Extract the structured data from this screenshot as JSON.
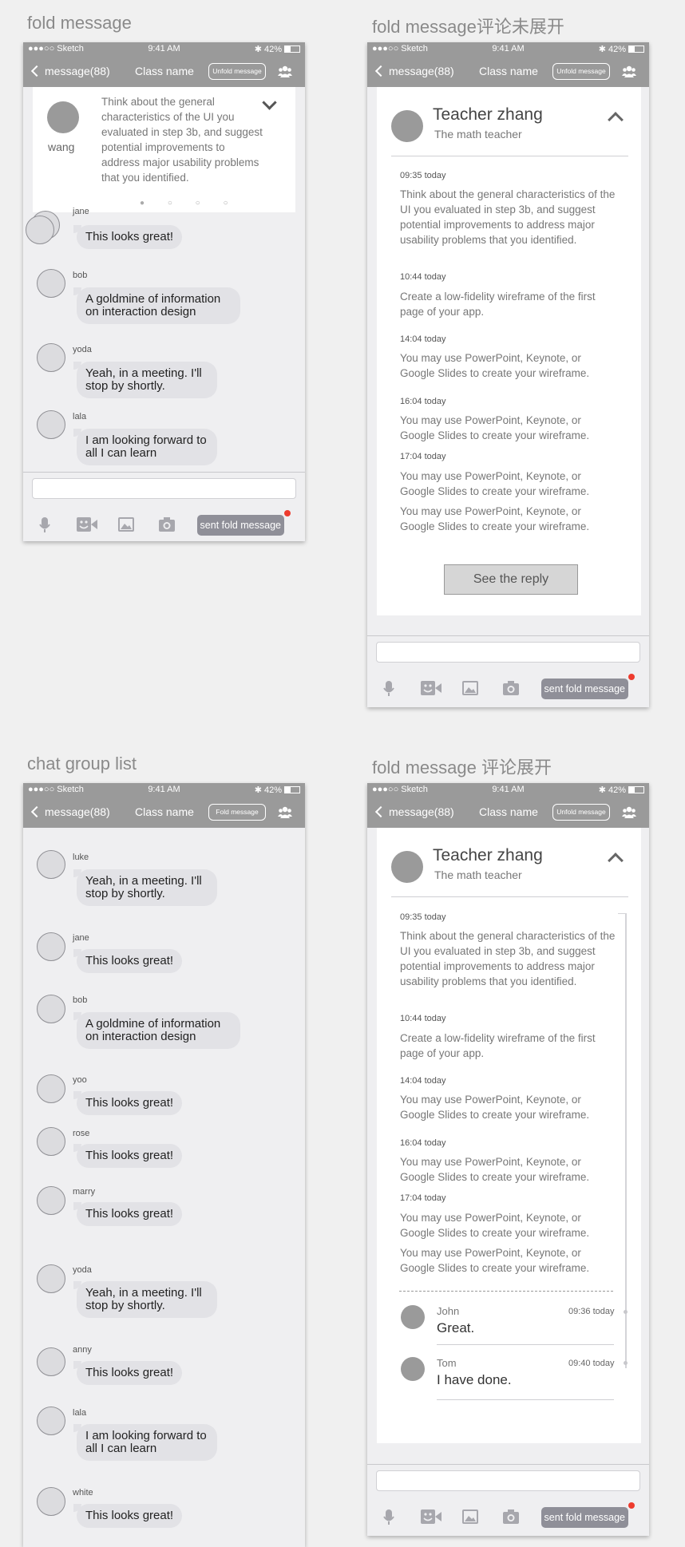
{
  "status": {
    "carrier": "●●●○○ Sketch",
    "time": "9:41 AM",
    "battery": "42%"
  },
  "nav": {
    "back": "message(88)",
    "title": "Class name",
    "unfold": "Unfold message",
    "fold": "Fold message"
  },
  "bottom": {
    "send": "sent fold message"
  },
  "s1": {
    "title": "fold message",
    "pinned": {
      "name": "wang",
      "text": "Think about the general characteristics of the UI you evaluated in step 3b, and suggest potential improvements to address major usability problems that you identified.",
      "dots": "● ○ ○ ○"
    },
    "messages": [
      {
        "name": "jane",
        "text": "This looks great!"
      },
      {
        "name": "bob",
        "text": "A goldmine of information on interaction design"
      },
      {
        "name": "yoda",
        "text": "Yeah, in a meeting. I'll stop by shortly."
      },
      {
        "name": "lala",
        "text": "I am looking forward to all I can learn"
      }
    ]
  },
  "s2": {
    "title": "fold message评论未展开",
    "teacher": {
      "name": "Teacher zhang",
      "role": "The math teacher"
    },
    "entries": [
      {
        "time": "09:35 today",
        "text": "Think about the general characteristics of the UI you evaluated in step 3b, and suggest potential improvements to address major usability problems that you identified."
      },
      {
        "time": "10:44 today",
        "text": "Create a low-fidelity wireframe of the first page of your app."
      },
      {
        "time": "14:04 today",
        "text": "You may use PowerPoint, Keynote, or Google Slides to create your wireframe."
      },
      {
        "time": "16:04 today",
        "text": "You may use PowerPoint, Keynote, or Google Slides to create your wireframe."
      },
      {
        "time": "17:04 today",
        "text": "You may use PowerPoint, Keynote, or Google Slides to create your wireframe."
      },
      {
        "time": "",
        "text": "You may use PowerPoint, Keynote, or Google Slides to create your wireframe."
      }
    ],
    "reply_button": "See the reply"
  },
  "s3": {
    "title": "chat group list",
    "messages": [
      {
        "name": "luke",
        "text": "Yeah, in a meeting. I'll stop by shortly."
      },
      {
        "name": "jane",
        "text": "This looks great!"
      },
      {
        "name": "bob",
        "text": "A goldmine of information on interaction design"
      },
      {
        "name": "yoo",
        "text": "This looks great!"
      },
      {
        "name": "rose",
        "text": "This looks great!"
      },
      {
        "name": "marry",
        "text": "This looks great!"
      },
      {
        "name": "yoda",
        "text": "Yeah, in a meeting. I'll stop by shortly."
      },
      {
        "name": "anny",
        "text": "This looks great!"
      },
      {
        "name": "lala",
        "text": "I am looking forward to all I can learn"
      },
      {
        "name": "white",
        "text": "This looks great!"
      }
    ]
  },
  "s4": {
    "title": "fold message 评论展开",
    "teacher": {
      "name": "Teacher zhang",
      "role": "The math teacher"
    },
    "entries": [
      {
        "time": "09:35 today",
        "text": "Think about the general characteristics of the UI you evaluated in step 3b, and suggest potential improvements to address major usability problems that you identified."
      },
      {
        "time": "10:44 today",
        "text": "Create a low-fidelity wireframe of the first page of your app."
      },
      {
        "time": "14:04 today",
        "text": "You may use PowerPoint, Keynote, or Google Slides to create your wireframe."
      },
      {
        "time": "16:04 today",
        "text": "You may use PowerPoint, Keynote, or Google Slides to create your wireframe."
      },
      {
        "time": "17:04 today",
        "text": "You may use PowerPoint, Keynote, or Google Slides to create your wireframe."
      },
      {
        "time": "",
        "text": "You may use PowerPoint, Keynote, or Google Slides to create your wireframe."
      }
    ],
    "replies": [
      {
        "name": "John",
        "text": "Great.",
        "time": "09:36 today"
      },
      {
        "name": "Tom",
        "text": "I have done.",
        "time": "09:40 today"
      }
    ]
  },
  "icons": [
    "mic-icon",
    "sticker-icon",
    "image-icon",
    "camera-icon",
    "group-icon",
    "back-chevron-icon"
  ]
}
